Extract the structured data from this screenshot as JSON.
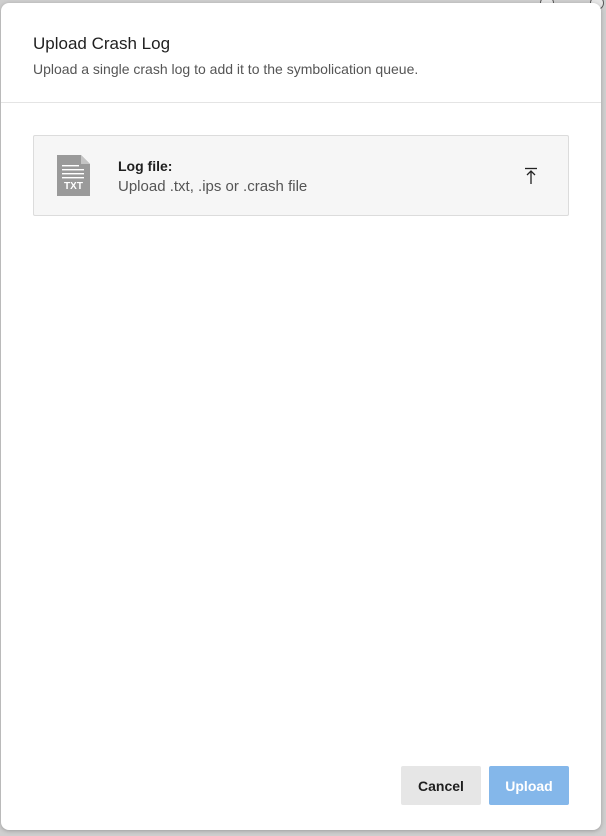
{
  "modal": {
    "title": "Upload Crash Log",
    "subtitle": "Upload a single crash log to add it to the symbolication queue."
  },
  "file_input": {
    "label": "Log file:",
    "hint": "Upload .txt, .ips or .crash file",
    "file_icon_text": "TXT",
    "file_icon": "txt-file-icon",
    "upload_icon": "upload-arrow-icon"
  },
  "footer": {
    "cancel_label": "Cancel",
    "upload_label": "Upload",
    "upload_color": "#84b7ea",
    "cancel_color": "#e6e6e6"
  }
}
